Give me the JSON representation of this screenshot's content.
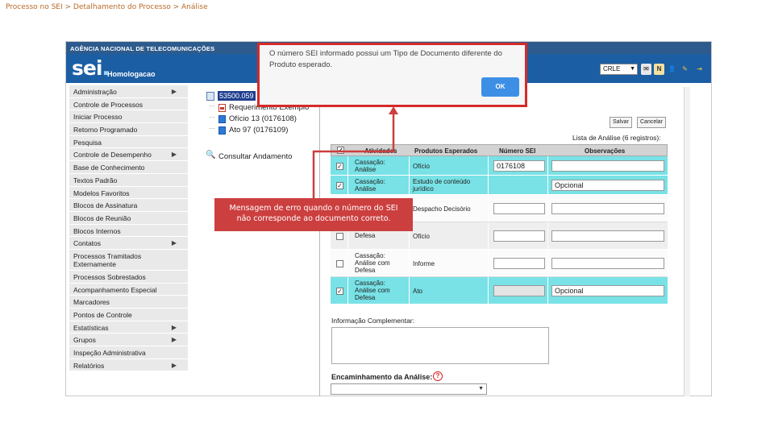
{
  "slide_title": "Processo no SEI > Detalhamento do Processo > Análise",
  "app": {
    "agency": "AGÊNCIA NACIONAL DE TELECOMUNICAÇÕES",
    "logo_text": "sei",
    "logo_dot": ".",
    "environment": "Homologacao",
    "unit": "CRLE"
  },
  "menu": [
    {
      "label": "Administração",
      "submenu": true
    },
    {
      "label": "Controle de Processos",
      "submenu": false
    },
    {
      "label": "Iniciar Processo",
      "submenu": false
    },
    {
      "label": "Retorno Programado",
      "submenu": false
    },
    {
      "label": "Pesquisa",
      "submenu": false
    },
    {
      "label": "Controle de Desempenho",
      "submenu": true
    },
    {
      "label": "Base de Conhecimento",
      "submenu": false
    },
    {
      "label": "Textos Padrão",
      "submenu": false
    },
    {
      "label": "Modelos Favoritos",
      "submenu": false
    },
    {
      "label": "Blocos de Assinatura",
      "submenu": false
    },
    {
      "label": "Blocos de Reunião",
      "submenu": false
    },
    {
      "label": "Blocos Internos",
      "submenu": false
    },
    {
      "label": "Contatos",
      "submenu": true
    },
    {
      "label": "Processos Tramitados Externamente",
      "submenu": false
    },
    {
      "label": "Processos Sobrestados",
      "submenu": false
    },
    {
      "label": "Acompanhamento Especial",
      "submenu": false
    },
    {
      "label": "Marcadores",
      "submenu": false
    },
    {
      "label": "Pontos de Controle",
      "submenu": false
    },
    {
      "label": "Estatísticas",
      "submenu": true
    },
    {
      "label": "Grupos",
      "submenu": true
    },
    {
      "label": "Inspeção Administrativa",
      "submenu": false
    },
    {
      "label": "Relatórios",
      "submenu": true
    }
  ],
  "tree": {
    "process_number": "53500.059",
    "documents": [
      {
        "label": "Requerimento Exemplo",
        "icon": "pdf-icon"
      },
      {
        "label": "Ofício 13 (0176108)",
        "icon": "word-doc-icon"
      },
      {
        "label": "Ato 97 (0176109)",
        "icon": "word-doc-icon"
      }
    ],
    "consult": "Consultar Andamento"
  },
  "buttons": {
    "save": "Salvar",
    "cancel": "Cancelar"
  },
  "list_title": "Lista de Análise (6 registros):",
  "grid": {
    "headers": {
      "activity": "Atividades",
      "products": "Produtos Esperados",
      "sei": "Número SEI",
      "notes": "Observações"
    },
    "rows": [
      {
        "checked": true,
        "activity": "Cassação: Análise",
        "product": "Ofício",
        "sei": "0176108",
        "obs": "",
        "style": "sel",
        "sei_input": true
      },
      {
        "checked": true,
        "activity": "Cassação: Análise",
        "product": "Estudo de conteúdo jurídico",
        "sei": "",
        "obs": "Opcional",
        "style": "sel",
        "sei_input": false
      },
      {
        "checked": false,
        "activity": "",
        "product": "Despacho Decisório",
        "sei": "",
        "obs": "",
        "style": "white",
        "sei_input": true
      },
      {
        "checked": false,
        "activity": "Análise com Defesa",
        "product": "Ofício",
        "sei": "",
        "obs": "",
        "style": "plain",
        "sei_input": true
      },
      {
        "checked": false,
        "activity": "Cassação: Análise com Defesa",
        "product": "Informe",
        "sei": "",
        "obs": "",
        "style": "white",
        "sei_input": true
      },
      {
        "checked": true,
        "activity": "Cassação: Análise com Defesa",
        "product": "Ato",
        "sei": "",
        "obs": "Opcional",
        "style": "sel",
        "sei_input": true,
        "sei_gray": true
      }
    ]
  },
  "complement_label": "Informação Complementar:",
  "forward_label": "Encaminhamento da Análise:",
  "alert": {
    "message": "O número SEI informado possui um Tipo de Documento diferente do Produto esperado.",
    "ok": "OK"
  },
  "callout": {
    "line1": "Mensagem de erro quando o número do SEI",
    "line2": "não corresponde ao documento correto."
  },
  "colors": {
    "accent_red": "#d62a2a",
    "header_blue": "#1b5ea3",
    "selected_row": "#78e2e6"
  }
}
